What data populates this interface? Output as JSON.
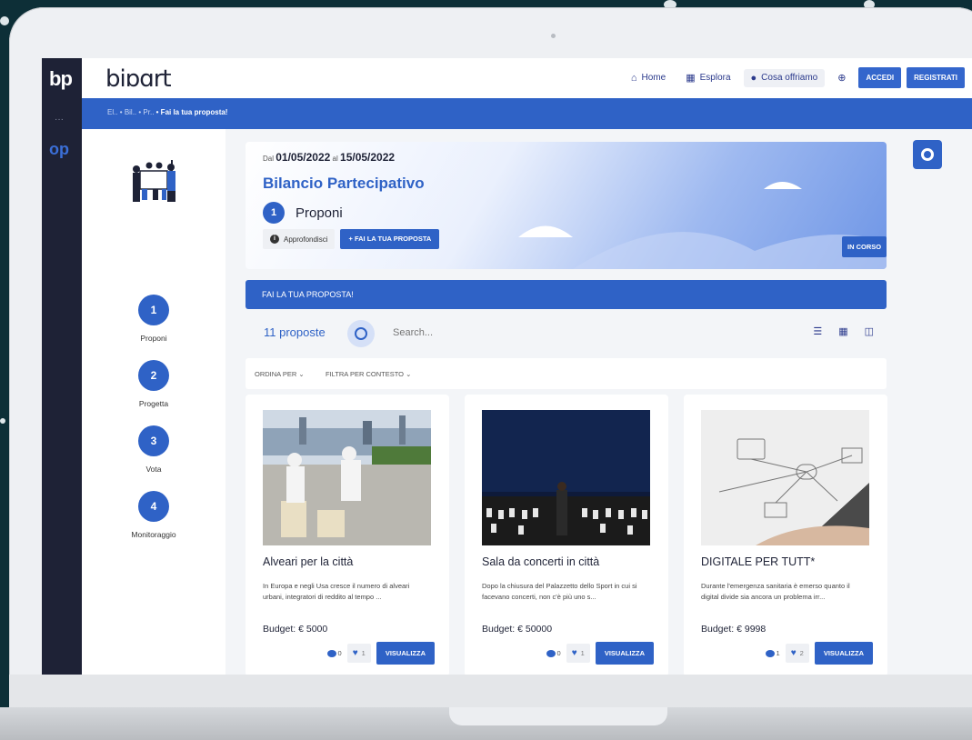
{
  "brand": {
    "rail_logo": "bp",
    "rail_logo_small": "op",
    "name": "biɒɑrt"
  },
  "nav": {
    "home": "Home",
    "explore": "Esplora",
    "offer": "Cosa offriamo",
    "login": "ACCEDI",
    "register": "REGISTRATI"
  },
  "breadcrumb": {
    "c1": "El..",
    "c2": "• Bil..",
    "c3": "• Pr..",
    "current": "• Fai la tua proposta!"
  },
  "steps": [
    {
      "num": "1",
      "label": "Proponi"
    },
    {
      "num": "2",
      "label": "Progetta"
    },
    {
      "num": "3",
      "label": "Vota"
    },
    {
      "num": "4",
      "label": "Monitoraggio"
    }
  ],
  "hero": {
    "from_prefix": "Dal",
    "from_date": "01/05/2022",
    "to_prefix": "al",
    "to_date": "15/05/2022",
    "title": "Bilancio Partecipativo",
    "phase_num": "1",
    "phase_label": "Proponi",
    "learn_more": "Approfondisci",
    "propose_btn": "FAI LA TUA PROPOSTA",
    "status": "IN CORSO"
  },
  "section": {
    "title": "FAI LA TUA PROPOSTA!"
  },
  "list": {
    "count": "11 proposte",
    "search_placeholder": "Search..."
  },
  "filters": {
    "order": "ORDINA PER ⌄",
    "context": "FILTRA PER CONTESTO ⌄"
  },
  "cards": [
    {
      "title": "Alveari per la città",
      "desc": "In Europa e negli Usa cresce il numero di alveari urbani, integratori di reddito al tempo ...",
      "budget": "Budget: € 5000",
      "comments": "0",
      "likes": "1",
      "button": "VISUALIZZA"
    },
    {
      "title": "Sala da concerti in città",
      "desc": "Dopo la chiusura del Palazzetto dello Sport in cui si facevano concerti, non c'è più uno s...",
      "budget": "Budget: € 50000",
      "comments": "0",
      "likes": "1",
      "button": "VISUALIZZA"
    },
    {
      "title": "DIGITALE PER TUTT*",
      "desc": "Durante l'emergenza sanitaria è emerso quanto il digital divide sia ancora un problema irr...",
      "budget": "Budget: € 9998",
      "comments": "1",
      "likes": "2",
      "button": "VISUALIZZA"
    }
  ],
  "colors": {
    "primary": "#2f62c6",
    "rail": "#1e2236",
    "background": "#0d2f37"
  }
}
